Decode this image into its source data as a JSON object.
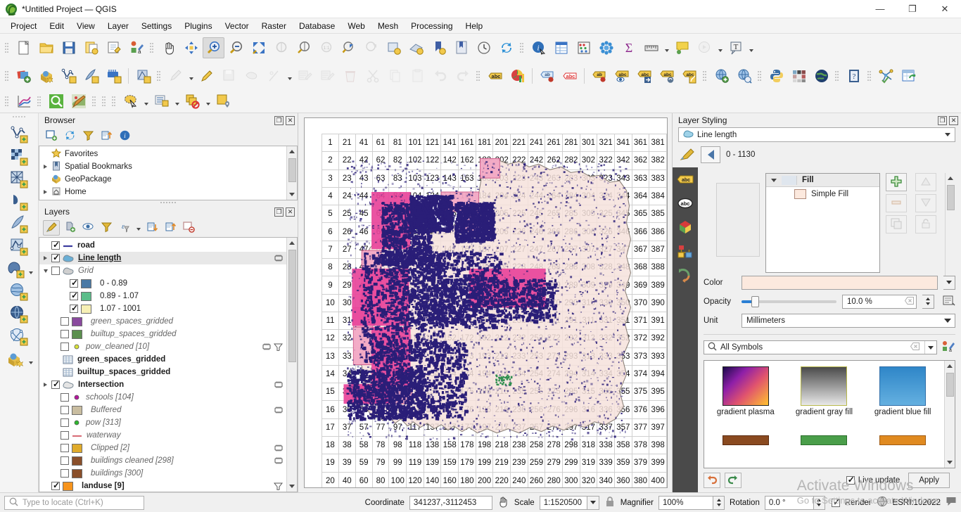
{
  "window": {
    "title": "*Untitled Project — QGIS",
    "controls": {
      "minimize": "—",
      "maximize": "❐",
      "close": "✕"
    }
  },
  "menubar": {
    "items": [
      {
        "label": "Project"
      },
      {
        "label": "Edit"
      },
      {
        "label": "View"
      },
      {
        "label": "Layer"
      },
      {
        "label": "Settings"
      },
      {
        "label": "Plugins"
      },
      {
        "label": "Vector"
      },
      {
        "label": "Raster"
      },
      {
        "label": "Database"
      },
      {
        "label": "Web"
      },
      {
        "label": "Mesh"
      },
      {
        "label": "Processing"
      },
      {
        "label": "Help"
      }
    ]
  },
  "toolbar_row1": {
    "icons": [
      "new-project-icon",
      "open-project-icon",
      "save-project-icon",
      "save-project-as-icon",
      "new-print-layout-icon",
      "style-manager-icon",
      "pan-map-icon",
      "pan-to-selection-icon",
      "zoom-in-icon",
      "zoom-out-icon",
      "zoom-full-icon",
      "zoom-to-selection-icon",
      "zoom-to-layer-icon",
      "zoom-native-icon",
      "zoom-last-icon",
      "zoom-next-icon",
      "new-map-view-icon",
      "new-3d-map-view-icon",
      "bookmark-add-icon",
      "show-bookmarks-icon",
      "temporal-controller-icon",
      "refresh-icon",
      "identify-features-icon",
      "open-attribute-table-icon",
      "field-calculator-icon",
      "statistical-summary-icon",
      "sum-icon",
      "measure-line-icon",
      "map-tips-icon",
      "show-deselect-icon",
      "text-annotation-icon"
    ]
  },
  "toolbar_row2": {
    "icons": [
      "add-layer-icon",
      "add-geopackage-icon",
      "add-vector-layer-icon",
      "add-delimited-text-icon",
      "add-mesh-layer-icon",
      "add-spatial-layer-icon",
      "toggle-editing-icon",
      "edit-pencil-icon",
      "save-edits-icon",
      "add-polygon-feature-icon",
      "vertex-tool-icon",
      "modify-attributes-icon",
      "multi-edit-icon",
      "delete-selected-icon",
      "cut-features-icon",
      "copy-features-icon",
      "paste-features-icon",
      "undo-icon",
      "redo-icon",
      "label-abc-icon",
      "diagram-icon",
      "pin-labels-icon",
      "highlight-labels-icon",
      "move-label-icon",
      "show-hide-labels-icon",
      "move-label-right-icon",
      "rotate-label-icon",
      "change-label-icon",
      "georeferencer-icon",
      "metasearch-icon",
      "python-console-icon",
      "qgis2web-icon",
      "globe-icon",
      "help-icon",
      "network-analysis-icon",
      "refresh-table-icon"
    ]
  },
  "toolbar_row3": {
    "icons": [
      "plot-icon",
      "select-by-expression-icon",
      "styling-dock-icon",
      "select-features-icon",
      "open-form-icon",
      "deselect-all-icon",
      "select-value-icon"
    ]
  },
  "rail": {
    "icons": [
      "add-vector-layer-icon",
      "add-raster-layer-icon",
      "add-mesh-layer-icon",
      "add-delimited-text-layer-icon",
      "add-spatialite-layer-icon",
      "add-gpx-layer-icon",
      "add-postgis-layer-icon",
      "add-mssql-layer-icon",
      "add-wms-layer-icon",
      "add-wfs-layer-icon",
      "add-geopackage-layer-icon"
    ]
  },
  "browser_panel": {
    "title": "Browser",
    "toolbar": [
      "add-selected-layers-icon",
      "refresh-icon",
      "filter-browser-icon",
      "collapse-all-icon",
      "properties-icon"
    ],
    "items": [
      {
        "label": "Favorites",
        "icon": "star-icon",
        "expander": "none"
      },
      {
        "label": "Spatial Bookmarks",
        "icon": "bookmark-icon",
        "expander": "right"
      },
      {
        "label": "GeoPackage",
        "icon": "geopackage-icon",
        "expander": "none"
      },
      {
        "label": "Home",
        "icon": "home-icon",
        "expander": "right"
      }
    ]
  },
  "layers_panel": {
    "title": "Layers",
    "toolbar": [
      "open-layer-styling-icon",
      "add-group-icon",
      "manage-visibility-icon",
      "filter-legend-icon",
      "expression-filter-icon",
      "expand-all-icon",
      "collapse-all-icon",
      "remove-layer-icon"
    ],
    "items": [
      {
        "label": "road",
        "checked": true,
        "style": "bold",
        "icon": "line-symbol",
        "color": "#3b3b9e",
        "indent": 1,
        "expander": "none",
        "actions": []
      },
      {
        "label": "Line length",
        "checked": true,
        "style": "underline",
        "icon": "polygon-symbol",
        "color": "#6aafd6",
        "indent": 1,
        "expander": "right",
        "selected": true,
        "actions": [
          "memory-layer-icon"
        ]
      },
      {
        "label": "Grid",
        "checked": false,
        "style": "italic",
        "icon": "polygon-symbol",
        "color": "#cfcfcf",
        "indent": 1,
        "expander": "down",
        "actions": []
      },
      {
        "label": "0 - 0.89",
        "checked": true,
        "style": "plain",
        "icon": "swatch",
        "color": "#4a79a5",
        "indent": 3,
        "expander": "none",
        "actions": []
      },
      {
        "label": "0.89 - 1.07",
        "checked": true,
        "style": "plain",
        "icon": "swatch",
        "color": "#5bbd8a",
        "indent": 3,
        "expander": "none",
        "actions": []
      },
      {
        "label": "1.07 - 1001",
        "checked": true,
        "style": "plain",
        "icon": "swatch",
        "color": "#f7f0b5",
        "indent": 3,
        "expander": "none",
        "actions": []
      },
      {
        "label": "green_spaces_gridded",
        "checked": false,
        "style": "italic",
        "icon": "swatch",
        "color": "#8a4a9e",
        "indent": 2,
        "expander": "none",
        "actions": []
      },
      {
        "label": "builtup_spaces_gridded",
        "checked": false,
        "style": "italic",
        "icon": "swatch",
        "color": "#5b8f4e",
        "indent": 2,
        "expander": "none",
        "actions": []
      },
      {
        "label": "pow_cleaned [10]",
        "checked": false,
        "style": "italic",
        "icon": "point-symbol",
        "color": "#d8e23a",
        "indent": 2,
        "expander": "none",
        "actions": [
          "memory-layer-icon",
          "filter-icon"
        ]
      },
      {
        "label": "green_spaces_gridded",
        "checked": null,
        "style": "bold",
        "icon": "table-icon",
        "color": "#9aa8c0",
        "indent": 1,
        "expander": "none",
        "actions": []
      },
      {
        "label": "builtup_spaces_gridded",
        "checked": null,
        "style": "bold",
        "icon": "table-icon",
        "color": "#9aa8c0",
        "indent": 1,
        "expander": "none",
        "actions": []
      },
      {
        "label": "Intersection",
        "checked": true,
        "style": "bold",
        "icon": "polygon-symbol",
        "color": "#e4e4e4",
        "indent": 1,
        "expander": "right",
        "actions": [
          "memory-layer-icon"
        ]
      },
      {
        "label": "schools [104]",
        "checked": false,
        "style": "italic",
        "icon": "point-symbol",
        "color": "#b5179e",
        "indent": 2,
        "expander": "none",
        "actions": []
      },
      {
        "label": "Buffered",
        "checked": false,
        "style": "italic",
        "icon": "swatch",
        "color": "#c9bda0",
        "indent": 2,
        "expander": "none",
        "actions": [
          "memory-layer-icon"
        ]
      },
      {
        "label": "pow [313]",
        "checked": false,
        "style": "italic",
        "icon": "point-symbol",
        "color": "#2eb82e",
        "indent": 2,
        "expander": "none",
        "actions": []
      },
      {
        "label": "waterway",
        "checked": false,
        "style": "italic",
        "icon": "line-symbol",
        "color": "#d9707a",
        "indent": 2,
        "expander": "none",
        "actions": []
      },
      {
        "label": "Clipped [2]",
        "checked": false,
        "style": "italic",
        "icon": "swatch",
        "color": "#e0ab2b",
        "indent": 2,
        "expander": "none",
        "actions": [
          "memory-layer-icon"
        ]
      },
      {
        "label": "buildings cleaned [298]",
        "checked": false,
        "style": "italic",
        "icon": "swatch",
        "color": "#8a4f2a",
        "indent": 2,
        "expander": "none",
        "actions": [
          "memory-layer-icon"
        ]
      },
      {
        "label": "buildings [300]",
        "checked": false,
        "style": "italic",
        "icon": "swatch",
        "color": "#8a4f2a",
        "indent": 2,
        "expander": "none",
        "actions": []
      },
      {
        "label": "landuse [9]",
        "checked": true,
        "style": "bold",
        "icon": "swatch",
        "color": "#f7941d",
        "indent": 1,
        "expander": "none",
        "actions": [
          "filter-icon"
        ]
      }
    ]
  },
  "layer_styling": {
    "title": "Layer Styling",
    "layer_selector": "Line length",
    "class_label": "0 - 1130",
    "side_tabs": [
      "labels-icon",
      "masks-icon",
      "3d-view-icon",
      "diagrams-icon",
      "history-icon"
    ],
    "symbol_tree": {
      "root": "Fill",
      "child": "Simple Fill"
    },
    "fields": {
      "color_label": "Color",
      "color_value": "#fce9de",
      "opacity_label": "Opacity",
      "opacity_value": "10.0 %",
      "unit_label": "Unit",
      "unit_value": "Millimeters"
    },
    "symbol_search": {
      "placeholder": "All Symbols",
      "value": "All Symbols"
    },
    "gallery": [
      {
        "name": "gradient plasma",
        "kind": "gradient-plasma"
      },
      {
        "name": "gradient  gray fill",
        "kind": "gradient-gray"
      },
      {
        "name": "gradient blue fill",
        "kind": "gradient-blue"
      },
      {
        "name": "",
        "kind": "brown"
      },
      {
        "name": "",
        "kind": "green"
      },
      {
        "name": "",
        "kind": "orange"
      }
    ],
    "footer": {
      "undo": "undo-icon",
      "redo": "redo-icon",
      "live_update_label": "Live update",
      "live_update_checked": true,
      "apply_label": "Apply"
    }
  },
  "watermark": {
    "line1": "Activate Windows",
    "line2": "Go to Settings to activate Windows."
  },
  "statusbar": {
    "locate_placeholder": "Type to locate (Ctrl+K)",
    "coordinate_label": "Coordinate",
    "coordinate_value": "341237,-3112453",
    "scale_label": "Scale",
    "scale_value": "1:1520500",
    "magnifier_label": "Magnifier",
    "magnifier_value": "100%",
    "rotation_label": "Rotation",
    "rotation_value": "0.0 °",
    "render_label": "Render",
    "render_checked": true,
    "crs_value": "ESRI:102022",
    "messages_icon": "message-log-icon"
  },
  "map": {
    "grid": {
      "rows": 20,
      "cols": 20,
      "numbering": "column-major",
      "min": 1,
      "max": 400
    },
    "region_fill": "#f6e2dc",
    "region_stroke": "#8c8279",
    "raster_dark": "#2a1e78",
    "raster_pink": "#e8449a",
    "raster_light_pink": "#f2a8c4"
  }
}
